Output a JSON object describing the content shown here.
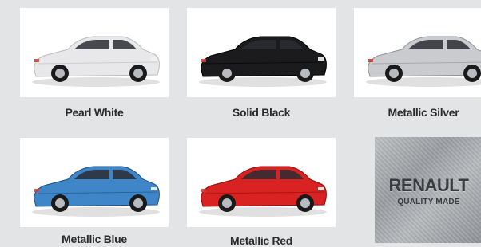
{
  "swatches": [
    {
      "label": "Pearl White",
      "color": "#e8e8ea",
      "shade": "#b9bcc0"
    },
    {
      "label": "Solid Black",
      "color": "#1b1b1d",
      "shade": "#000000"
    },
    {
      "label": "Metallic Silver",
      "color": "#c9cbce",
      "shade": "#8f9397"
    },
    {
      "label": "Metallic Blue",
      "color": "#3f86c8",
      "shade": "#1f4f80"
    },
    {
      "label": "Metallic Red",
      "color": "#d92222",
      "shade": "#8a0d0d"
    }
  ],
  "badge": {
    "brand": "RENAULT",
    "tagline": "QUALITY MADE"
  }
}
